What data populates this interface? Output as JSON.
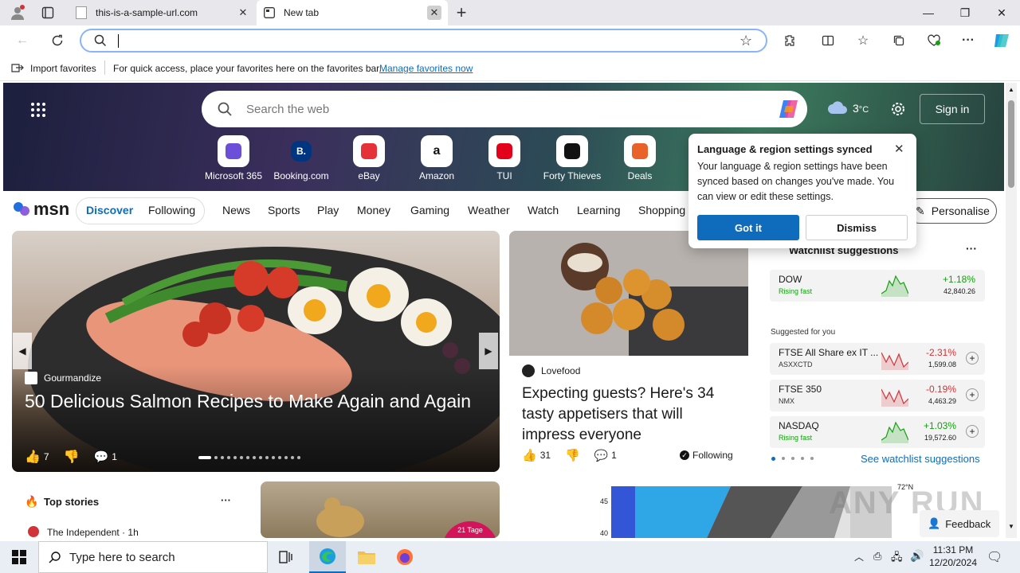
{
  "browser": {
    "tabs": [
      {
        "title": "this-is-a-sample-url.com",
        "active": false
      },
      {
        "title": "New tab",
        "active": true
      }
    ],
    "new_tab_symbol": "+",
    "address_value": ""
  },
  "favbar": {
    "import_label": "Import favorites",
    "hint": "For quick access, place your favorites here on the favorites bar.",
    "manage_link": "Manage favorites now"
  },
  "msn": {
    "search_placeholder": "Search the web",
    "weather": "3",
    "weather_unit": "°C",
    "sign_in": "Sign in",
    "quick_links": [
      {
        "label": "Microsoft 365",
        "icon": "microsoft-365-icon",
        "color": "#6b4fd8"
      },
      {
        "label": "Booking.com",
        "icon": "booking-icon",
        "glyph": "B.",
        "color": "#003580"
      },
      {
        "label": "eBay",
        "icon": "ebay-icon",
        "color": "#e53238"
      },
      {
        "label": "Amazon",
        "icon": "amazon-icon",
        "glyph": "a",
        "color": "#111"
      },
      {
        "label": "TUI",
        "icon": "tui-icon",
        "color": "#e3001b"
      },
      {
        "label": "Forty Thieves",
        "icon": "forty-thieves-icon",
        "color": "#111"
      },
      {
        "label": "Deals",
        "icon": "deals-icon",
        "color": "#e8622a"
      }
    ],
    "logo": "msn",
    "feed_tabs": {
      "discover": "Discover",
      "following": "Following"
    },
    "nav": [
      "News",
      "Sports",
      "Play",
      "Money",
      "Gaming",
      "Weather",
      "Watch",
      "Learning",
      "Shopping"
    ],
    "personalise": "Personalise"
  },
  "popup": {
    "title": "Language & region settings synced",
    "body": "Your language & region settings have been synced based on changes you've made. You can view or edit these settings.",
    "got_it": "Got it",
    "dismiss": "Dismiss"
  },
  "hero_card": {
    "source": "Gourmandize",
    "title": "50 Delicious Salmon Recipes to Make Again and Again",
    "likes": "7",
    "comments": "1"
  },
  "second_card": {
    "source": "Lovefood",
    "title": "Expecting guests? Here's 34 tasty appetisers that will impress everyone",
    "likes": "31",
    "comments": "1",
    "following": "Following"
  },
  "watchlist": {
    "title": "Watchlist suggestions",
    "suggested_label": "Suggested for you",
    "items": [
      {
        "name": "DOW",
        "sub": "Rising fast",
        "change": "+1.18%",
        "value": "42,840.26",
        "up": true
      },
      {
        "name": "FTSE All Share ex IT ...",
        "sub": "ASXXCTD",
        "change": "-2.31%",
        "value": "1,599.08",
        "up": false
      },
      {
        "name": "FTSE 350",
        "sub": "NMX",
        "change": "-0.19%",
        "value": "4,463.29",
        "up": false
      },
      {
        "name": "NASDAQ",
        "sub": "Rising fast",
        "change": "+1.03%",
        "value": "19,572.60",
        "up": true
      }
    ],
    "see_more": "See watchlist suggestions"
  },
  "top_stories": {
    "title": "Top stories",
    "first_source": "The Independent · 1h"
  },
  "bottom_badge": "21 Tage",
  "map_ticks": [
    "45",
    "40"
  ],
  "map_label": "72°N",
  "feedback": "Feedback",
  "watermark": "ANY RUN",
  "taskbar": {
    "search_placeholder": "Type here to search",
    "time": "11:31 PM",
    "date": "12/20/2024"
  },
  "colors": {
    "accent": "#0f6cbd",
    "up": "#13a10e",
    "down": "#d13438"
  }
}
